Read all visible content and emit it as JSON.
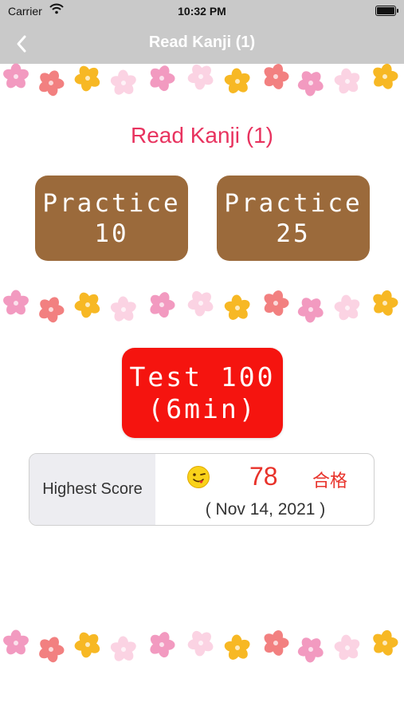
{
  "status_bar": {
    "carrier": "Carrier",
    "time": "10:32 PM",
    "icons": [
      "wifi-icon",
      "battery-icon"
    ]
  },
  "nav": {
    "back_icon": "chevron-left-icon",
    "title": "Read Kanji (1)"
  },
  "heading": "Read Kanji (1)",
  "buttons": {
    "practice_10": {
      "line1": "Practice",
      "line2": "10"
    },
    "practice_25": {
      "line1": "Practice",
      "line2": "25"
    },
    "test": {
      "line1": "Test 100",
      "line2": "(6min)"
    }
  },
  "score": {
    "label": "Highest Score",
    "emoji_icon": "winking-face-tongue-icon",
    "value": "78",
    "result": "合格",
    "date": "( Nov 14, 2021 )"
  },
  "colors": {
    "nav_background": "#c9c9c9",
    "heading": "#e8335f",
    "practice_button": "#9b6a3b",
    "test_button": "#f5140f",
    "score_text": "#e8322a",
    "flower_pink": "#f29ac0",
    "flower_salmon": "#f28080",
    "flower_yellow": "#f7b824",
    "flower_light_pink": "#fbd3e3"
  }
}
